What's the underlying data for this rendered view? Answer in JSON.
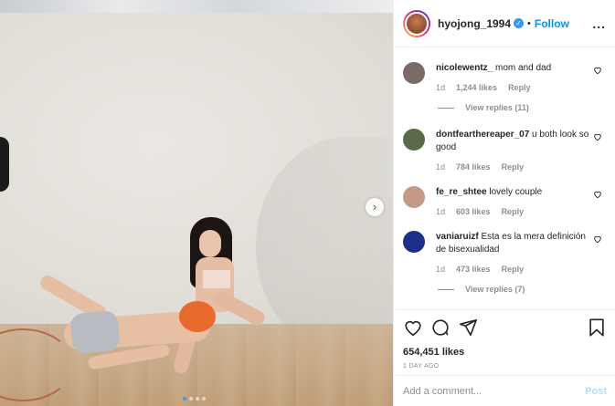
{
  "post": {
    "username": "hyojong_1994",
    "verified_glyph": "✓",
    "separator": "•",
    "follow_label": "Follow",
    "more_label": "...",
    "next_arrow": "›",
    "carousel_count": 4,
    "carousel_active": 1
  },
  "comments": [
    {
      "username": "nicolewentz_",
      "text": "mom and dad",
      "age": "1d",
      "likes": "1,244 likes",
      "reply": "Reply",
      "view_replies": "View replies (11)",
      "avatar_color": "#7a6a66"
    },
    {
      "username": "dontfearthereaper_07",
      "text": "u both look so good",
      "age": "1d",
      "likes": "784 likes",
      "reply": "Reply",
      "view_replies": "",
      "avatar_color": "#5b6b4a"
    },
    {
      "username": "fe_re_shtee",
      "text": "lovely couple",
      "age": "1d",
      "likes": "603 likes",
      "reply": "Reply",
      "view_replies": "",
      "avatar_color": "#c49a86"
    },
    {
      "username": "vaniaruizf",
      "text": "Esta es la mera definición de bisexualidad",
      "age": "1d",
      "likes": "473 likes",
      "reply": "Reply",
      "view_replies": "View replies (7)",
      "avatar_color": "#1c2f8a"
    }
  ],
  "footer": {
    "likes": "654,451 likes",
    "date": "1 DAY AGO",
    "comment_placeholder": "Add a comment...",
    "post_label": "Post"
  },
  "icons": [
    "heart-icon",
    "comment-icon",
    "share-icon",
    "bookmark-icon",
    "verified-badge-icon",
    "more-options-icon"
  ],
  "colors": {
    "link_blue": "#0095f6",
    "post_disabled": "#b3dbff",
    "muted": "#8e8e8e"
  }
}
